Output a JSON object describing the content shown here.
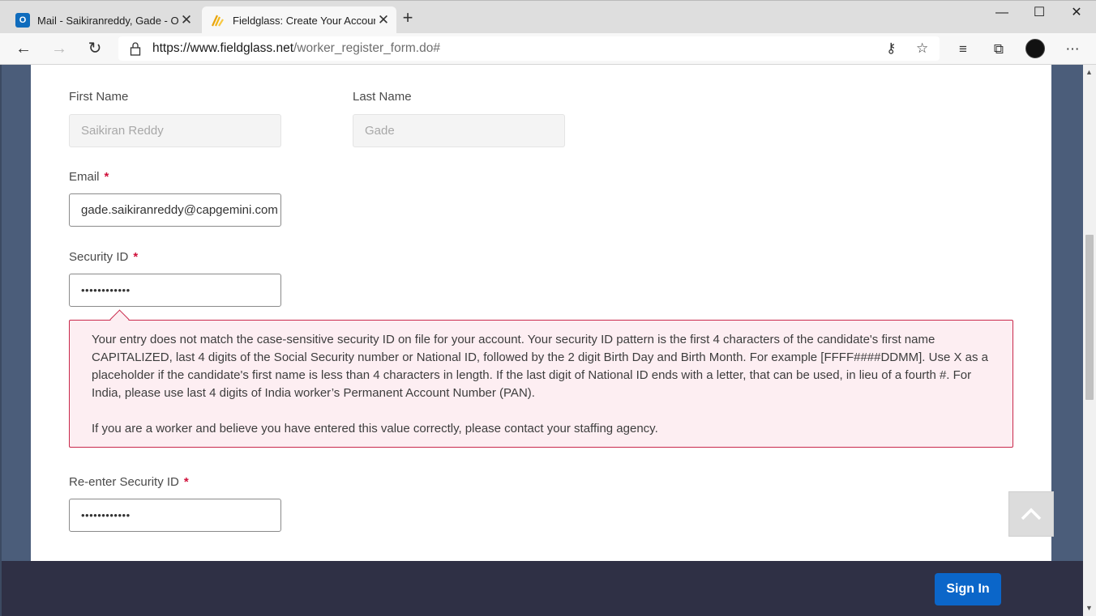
{
  "browser": {
    "tabs": [
      {
        "title": "Mail - Saikiranreddy, Gade - Outlook",
        "active": false,
        "icon": "outlook-icon"
      },
      {
        "title": "Fieldglass: Create Your Account",
        "active": true,
        "icon": "fieldglass-icon"
      }
    ],
    "url_host": "https://www.fieldglass.net",
    "url_path": "/worker_register_form.do#"
  },
  "form": {
    "first_name": {
      "label": "First Name",
      "value": "Saikiran Reddy",
      "disabled": true
    },
    "last_name": {
      "label": "Last Name",
      "value": "Gade",
      "disabled": true
    },
    "email": {
      "label": "Email",
      "required_mark": "*",
      "value": "gade.saikiranreddy@capgemini.com"
    },
    "security_id": {
      "label": "Security ID",
      "required_mark": "*",
      "value": "••••••••••••"
    },
    "reenter_security_id": {
      "label": "Re-enter Security ID",
      "required_mark": "*",
      "value": "••••••••••••"
    },
    "error": {
      "paragraph1": "Your entry does not match the case-sensitive security ID on file for your account. Your security ID pattern is the first 4 characters of the candidate's first name CAPITALIZED, last 4 digits of the Social Security number or National ID, followed by the 2 digit Birth Day and Birth Month. For example [FFFF####DDMM]. Use X as a placeholder if the candidate's first name is less than 4 characters in length. If the last digit of National ID ends with a letter, that can be used, in lieu of a fourth #. For India, please use last 4 digits of India worker’s Permanent Account Number (PAN).",
      "paragraph2": "If you are a worker and believe you have entered this value correctly, please contact your staffing agency."
    }
  },
  "footer": {
    "sign_in_label": "Sign In"
  },
  "colors": {
    "accent": "#0b66c9",
    "error_border": "#c9284b",
    "error_bg": "#fdeef2",
    "required": "#d0103a"
  }
}
